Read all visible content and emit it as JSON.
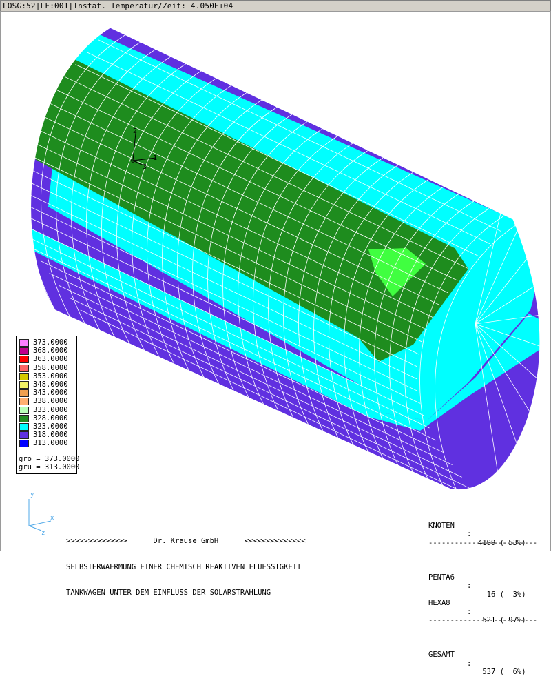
{
  "title_bar": "LOSG:52|LF:001|Instat. Temperatur/Zeit: 4.050E+04",
  "legend": {
    "entries": [
      {
        "value": "373.0000",
        "color": "#ff80ff"
      },
      {
        "value": "368.0000",
        "color": "#c0008c"
      },
      {
        "value": "363.0000",
        "color": "#ff0000"
      },
      {
        "value": "358.0000",
        "color": "#ff6666"
      },
      {
        "value": "353.0000",
        "color": "#d4c800"
      },
      {
        "value": "348.0000",
        "color": "#f0f066"
      },
      {
        "value": "343.0000",
        "color": "#f0a050"
      },
      {
        "value": "338.0000",
        "color": "#ffb070"
      },
      {
        "value": "333.0000",
        "color": "#b8ffb8"
      },
      {
        "value": "328.0000",
        "color": "#1e8c1e"
      },
      {
        "value": "323.0000",
        "color": "#00ffff"
      },
      {
        "value": "318.0000",
        "color": "#6030e0"
      },
      {
        "value": "313.0000",
        "color": "#0000ff"
      }
    ],
    "gro": "gro = 373.0000",
    "gru": "gru = 313.0000"
  },
  "triad_labels": {
    "y": "2",
    "x": "1",
    "z": "3"
  },
  "small_triad_labels": {
    "y": "y",
    "x": "x",
    "z": "z"
  },
  "footer": {
    "line1": ">>>>>>>>>>>>>>      Dr. Krause GmbH      <<<<<<<<<<<<<<",
    "line2": "SELBSTERWAERMUNG EINER CHEMISCH REAKTIVEN FLUESSIGKEIT",
    "line3": "TANKWAGEN UNTER DEM EINFLUSS DER SOLARSTRAHLUNG"
  },
  "stats": {
    "knoten": {
      "name": "KNOTEN",
      "value": "4199 ( 53%)"
    },
    "penta6": {
      "name": "PENTA6",
      "value": "  16 (  3%)"
    },
    "hexa8": {
      "name": "HEXA8",
      "value": " 521 ( 97%)"
    },
    "gesamt": {
      "name": "GESAMT",
      "value": " 537 (  6%)"
    },
    "separator": "-------------------------"
  },
  "colors": {
    "purple": "#6030e0",
    "cyan": "#00ffff",
    "green": "#1e8c1e",
    "lightgreen": "#40ff40",
    "mesh": "#ffffff"
  }
}
